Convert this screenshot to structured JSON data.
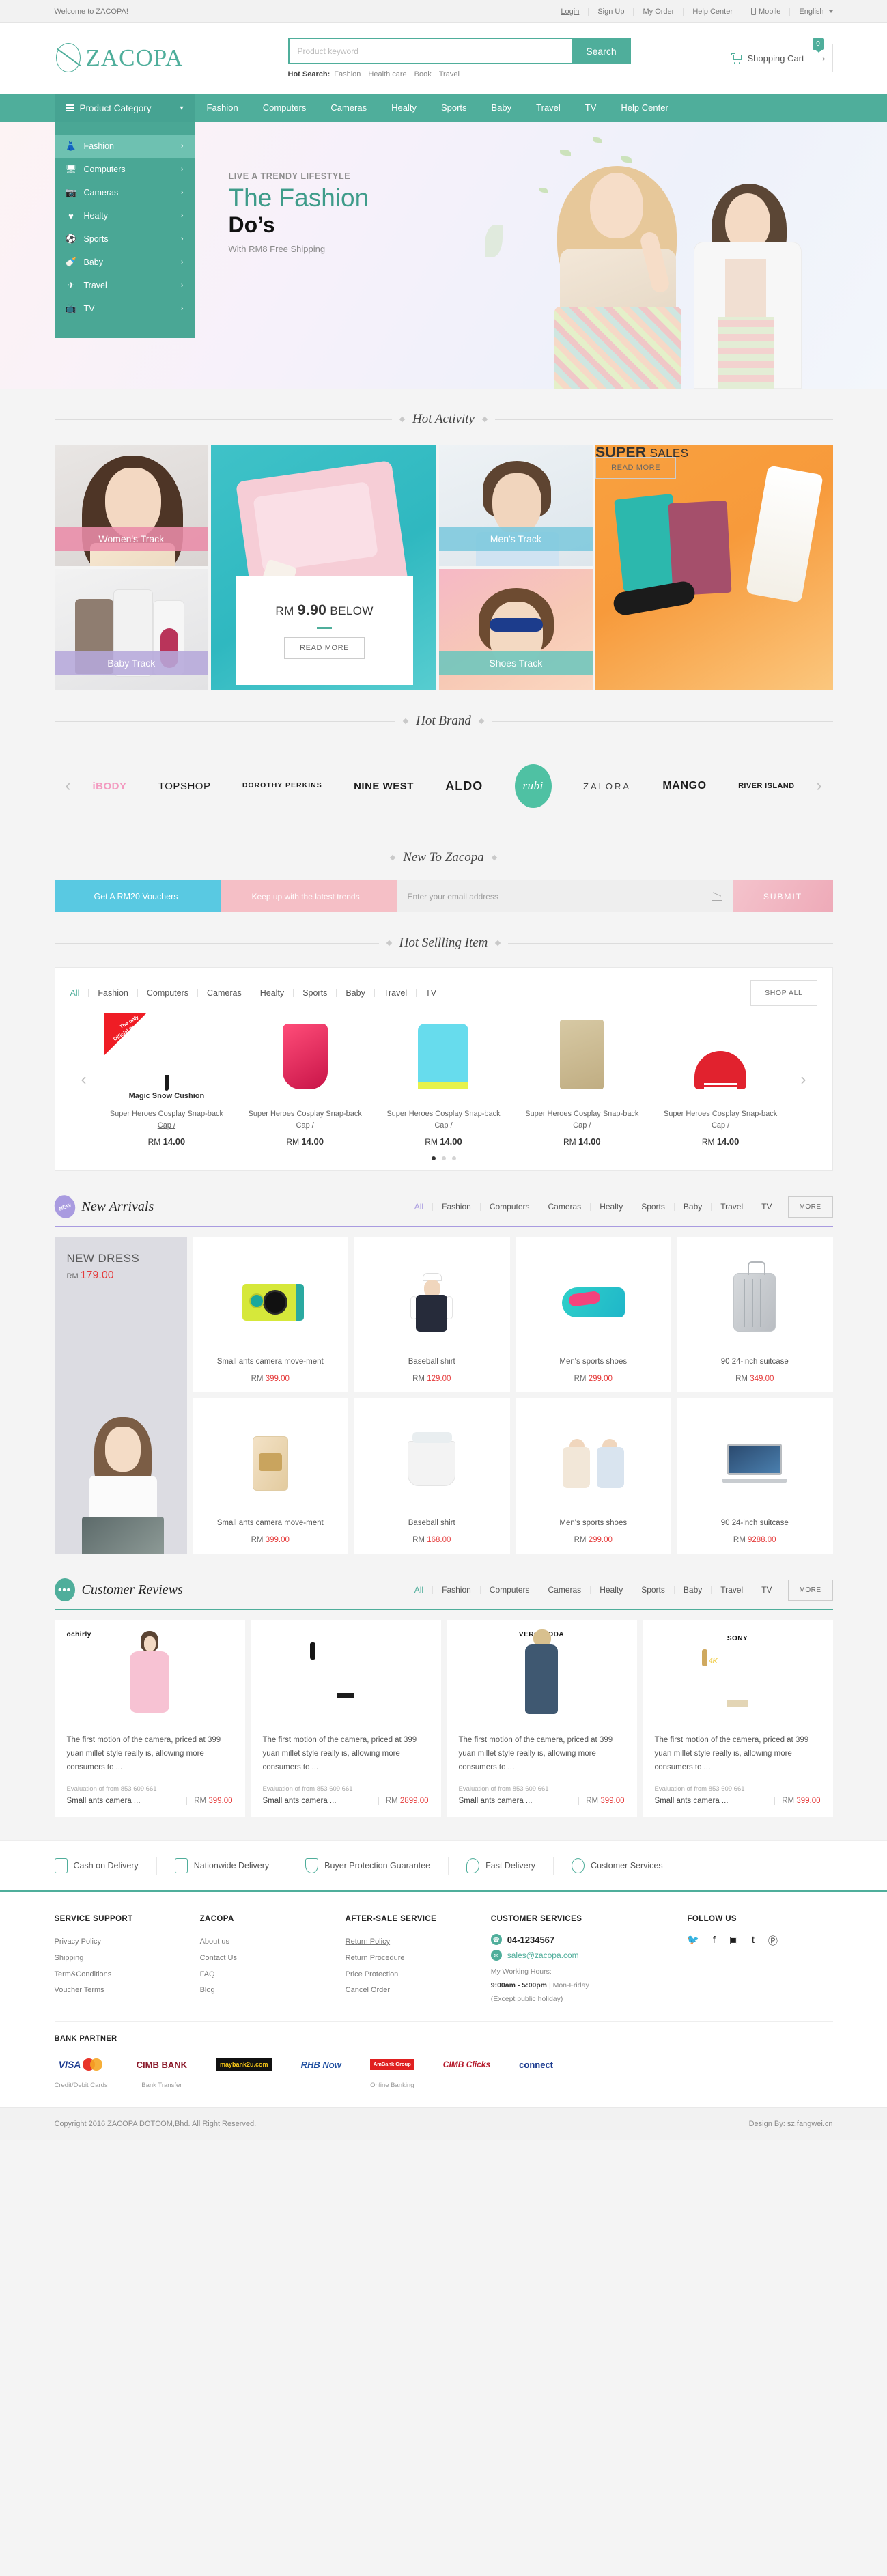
{
  "topbar": {
    "welcome": "Welcome to ZACOPA!",
    "links": [
      "Login",
      "Sign Up",
      "My Order",
      "Help Center"
    ],
    "mobile": "Mobile",
    "language": "English"
  },
  "header": {
    "brand": "ZACOPA",
    "search": {
      "placeholder": "Product keyword",
      "value": "",
      "button": "Search"
    },
    "hot_search_label": "Hot Search:",
    "hot_search_terms": [
      "Fashion",
      "Health care",
      "Book",
      "Travel"
    ],
    "cart": {
      "label": "Shopping Cart",
      "count": "0",
      "arrow": "›"
    }
  },
  "nav": {
    "category_button": "Product Category",
    "links": [
      "Fashion",
      "Computers",
      "Cameras",
      "Healty",
      "Sports",
      "Baby",
      "Travel",
      "TV",
      "Help Center"
    ]
  },
  "sidebar": {
    "items": [
      {
        "label": "Fashion",
        "icon": "jacket-icon",
        "glyph": "👗"
      },
      {
        "label": "Computers",
        "icon": "monitor-icon",
        "glyph": "🖵"
      },
      {
        "label": "Cameras",
        "icon": "camera-icon",
        "glyph": "📷"
      },
      {
        "label": "Healty",
        "icon": "heartbeat-icon",
        "glyph": "♥"
      },
      {
        "label": "Sports",
        "icon": "ball-icon",
        "glyph": "⚽"
      },
      {
        "label": "Baby",
        "icon": "bottle-icon",
        "glyph": "🍼"
      },
      {
        "label": "Travel",
        "icon": "plane-icon",
        "glyph": "✈"
      },
      {
        "label": "TV",
        "icon": "tv-icon",
        "glyph": "📺"
      }
    ],
    "chevron": "›"
  },
  "hero": {
    "kicker": "LIVE A TRENDY LIFESTYLE",
    "title_1": "The Fashion",
    "title_2": "Do’s",
    "subtitle": "With RM8 Free Shipping"
  },
  "hot_activity": {
    "heading": "Hot Activity",
    "women_band": "Women's Track",
    "baby_band": "Baby Track",
    "men_band": "Men's Track",
    "shoes_band": "Shoes Track",
    "promo_left": {
      "prefix": "RM ",
      "amount": "9.90",
      "suffix": " BELOW",
      "button": "READ MORE"
    },
    "promo_right": {
      "bold": "SUPER",
      "rest": " SALES",
      "button": "READ MORE"
    }
  },
  "hot_brand": {
    "heading": "Hot Brand",
    "prev": "‹",
    "next": "›",
    "brands": [
      "iBODY",
      "TOPSHOP",
      "DOROTHY PERKINS",
      "NINE WEST",
      "ALDO",
      "rubi",
      "ZALORA",
      "MANGO",
      "RIVER ISLAND"
    ]
  },
  "newsletter": {
    "heading": "New To Zacopa",
    "voucher": "Get A RM20 Vouchers",
    "tagline": "Keep up with the latest trends",
    "email_placeholder": "Enter your email address",
    "email_value": "",
    "submit": "SUBMIT"
  },
  "hot_selling": {
    "heading": "Hot Sellling Item",
    "tabs": [
      "All",
      "Fashion",
      "Computers",
      "Cameras",
      "Healty",
      "Sports",
      "Baby",
      "Travel",
      "TV"
    ],
    "active_tab": "All",
    "shop_all": "SHOP ALL",
    "prev": "‹",
    "next": "›",
    "ribbon_line1": "The only",
    "ribbon_line2": "Official Distributor",
    "first_caption": "Magic Snow Cushion",
    "items": [
      {
        "title": "Super Heroes Cosplay Snap-back Cap /",
        "price_prefix": "RM ",
        "price": "14.00"
      },
      {
        "title": "Super Heroes Cosplay Snap-back Cap /",
        "price_prefix": "RM ",
        "price": "14.00"
      },
      {
        "title": "Super Heroes Cosplay Snap-back Cap /",
        "price_prefix": "RM ",
        "price": "14.00"
      },
      {
        "title": "Super Heroes Cosplay Snap-back Cap /",
        "price_prefix": "RM ",
        "price": "14.00"
      },
      {
        "title": "Super Heroes Cosplay Snap-back Cap /",
        "price_prefix": "RM ",
        "price": "14.00"
      }
    ]
  },
  "new_arrivals": {
    "title": "New Arrivals",
    "badge": "NEW",
    "accent": "#a99be0",
    "tabs": [
      "All",
      "Fashion",
      "Computers",
      "Cameras",
      "Healty",
      "Sports",
      "Baby",
      "Travel",
      "TV"
    ],
    "active_tab": "All",
    "more": "MORE",
    "feature": {
      "title": "NEW DRESS",
      "price_prefix": "RM ",
      "price": "179.00"
    },
    "row1": [
      {
        "name": "Small ants camera move-ment",
        "price_prefix": "RM ",
        "price": "399.00",
        "art": "action-camera"
      },
      {
        "name": "Baseball shirt",
        "price_prefix": "RM ",
        "price": "129.00",
        "art": "baseball-shirt"
      },
      {
        "name": "Men's sports shoes",
        "price_prefix": "RM ",
        "price": "299.00",
        "art": "sport-shoe"
      },
      {
        "name": "90 24-inch suitcase",
        "price_prefix": "RM ",
        "price": "349.00",
        "art": "suitcase"
      }
    ],
    "row2": [
      {
        "name": "Small ants camera move-ment",
        "price_prefix": "RM ",
        "price": "399.00",
        "art": "milk-can"
      },
      {
        "name": "Baseball shirt",
        "price_prefix": "RM ",
        "price": "168.00",
        "art": "bucket"
      },
      {
        "name": "Men's sports shoes",
        "price_prefix": "RM ",
        "price": "299.00",
        "art": "couple"
      },
      {
        "name": "90 24-inch suitcase",
        "price_prefix": "RM ",
        "price": "9288.00",
        "art": "laptop"
      }
    ]
  },
  "reviews": {
    "title": "Customer Reviews",
    "badge": "•••",
    "accent": "#4fae9b",
    "tabs": [
      "All",
      "Fashion",
      "Computers",
      "Cameras",
      "Healty",
      "Sports",
      "Baby",
      "Travel",
      "TV"
    ],
    "active_tab": "All",
    "more": "MORE",
    "cards": [
      {
        "brand": "ochirly",
        "text": "The first motion of the camera, priced at 399 yuan millet style really is, allowing more consumers to ...",
        "meta": "Evaluation of from 853 609 661",
        "product": "Small ants camera ...",
        "price_prefix": "RM ",
        "price": "399.00",
        "art": "pink-dress"
      },
      {
        "brand": "",
        "text": "The first motion of the camera, priced at 399 yuan millet style really is, allowing more consumers to ...",
        "meta": "Evaluation of from 853 609 661",
        "product": "Small ants camera ...",
        "price_prefix": "RM ",
        "price": "2899.00",
        "art": "tv-sunset"
      },
      {
        "brand": "VERO MODA",
        "text": "The first motion of the camera, priced at 399 yuan millet style really is, allowing more consumers to ...",
        "meta": "Evaluation of from 853 609 661",
        "product": "Small ants camera ...",
        "price_prefix": "RM ",
        "price": "399.00",
        "art": "blue-dress"
      },
      {
        "brand": "SONY",
        "text": "The first motion of the camera, priced at 399 yuan millet style really is, allowing more consumers to ...",
        "meta": "Evaluation of from 853 609 661",
        "product": "Small ants camera ...",
        "price_prefix": "RM ",
        "price": "399.00",
        "art": "tv-4k"
      }
    ]
  },
  "services": [
    {
      "label": "Cash on Delivery",
      "icon": "cash-icon"
    },
    {
      "label": "Nationwide Delivery",
      "icon": "truck-icon"
    },
    {
      "label": "Buyer Protection Guarantee",
      "icon": "shield-icon"
    },
    {
      "label": "Fast Delivery",
      "icon": "clock-icon"
    },
    {
      "label": "Customer Services",
      "icon": "person-icon"
    }
  ],
  "footer": {
    "col1": {
      "title": "SERVICE SUPPORT",
      "links": [
        "Privacy Policy",
        "Shipping",
        "Term&Conditions",
        "Voucher Terms"
      ]
    },
    "col2": {
      "title": "ZACOPA",
      "links": [
        "About us",
        "Contact Us",
        "FAQ",
        "Blog"
      ]
    },
    "col3": {
      "title": "AFTER-SALE SERVICE",
      "links": [
        "Return Policy",
        "Return Procedure",
        "Price Protection",
        "Cancel Order"
      ]
    },
    "col4": {
      "title": "CUSTOMER SERVICES",
      "phone": "04-1234567",
      "email": "sales@zacopa.com",
      "hours_label": "My  Working Hours:",
      "hours_time": "9:00am - 5:00pm",
      "hours_days": "| Mon-Friday",
      "hours_note": "(Except public holiday)"
    },
    "col5": {
      "title": "FOLLOW US",
      "socials": [
        {
          "name": "twitter-icon",
          "glyph": "🐦"
        },
        {
          "name": "facebook-icon",
          "glyph": "f"
        },
        {
          "name": "instagram-icon",
          "glyph": "▣"
        },
        {
          "name": "tumblr-icon",
          "glyph": "t"
        },
        {
          "name": "pinterest-icon",
          "glyph": "Ⓟ"
        }
      ]
    },
    "bank": {
      "title": "BANK PARTNER",
      "groups": [
        {
          "caption": "Credit/Debit Cards",
          "logos": [
            "VISA",
            "MasterCard"
          ]
        },
        {
          "caption": "Bank Transfer",
          "logos": [
            "CIMB BANK"
          ]
        },
        {
          "caption": "",
          "logos": [
            "maybank2u.com"
          ]
        },
        {
          "caption": "",
          "logos": [
            "RHB Now"
          ]
        },
        {
          "caption": "Online Banking",
          "logos": [
            "AmBank Group"
          ]
        },
        {
          "caption": "",
          "logos": [
            "CIMB Clicks"
          ]
        },
        {
          "caption": "",
          "logos": [
            "connect"
          ]
        }
      ]
    },
    "copyright": "Copyright 2016 ZACOPA DOTCOM,Bhd. All Right Reserved.",
    "design_by": "Design By: sz.fangwei.cn"
  }
}
